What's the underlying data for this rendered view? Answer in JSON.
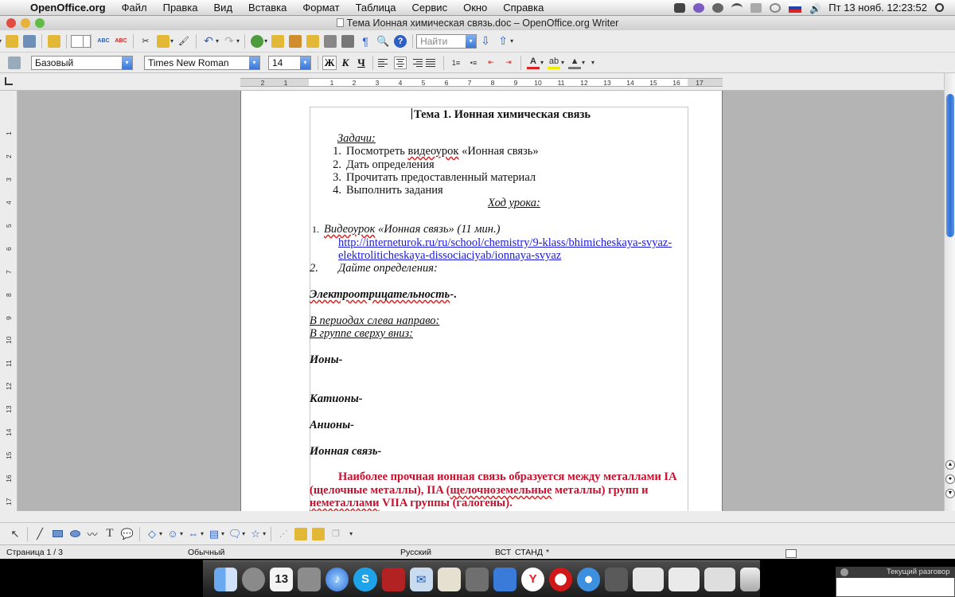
{
  "menubar": {
    "app_name": "OpenOffice.org",
    "items": [
      "Файл",
      "Правка",
      "Вид",
      "Вставка",
      "Формат",
      "Таблица",
      "Сервис",
      "Окно",
      "Справка"
    ],
    "clock": "Пт 13 нояб.  12:23:52"
  },
  "window": {
    "title": "Тема Ионная химическая связь.doc – OpenOffice.org Writer"
  },
  "toolbar": {
    "search_placeholder": "Найти"
  },
  "formatting": {
    "style": "Базовый",
    "font": "Times New Roman",
    "size": "14",
    "bold_label": "Ж",
    "italic_label": "К",
    "underline_label": "Ч"
  },
  "ruler": {
    "labels": [
      "2",
      "1",
      "",
      "1",
      "2",
      "3",
      "4",
      "5",
      "6",
      "7",
      "8",
      "9",
      "10",
      "11",
      "12",
      "13",
      "14",
      "15",
      "16",
      "17"
    ]
  },
  "vruler": {
    "labels": [
      "1",
      "2",
      "3",
      "4",
      "5",
      "6",
      "7",
      "8",
      "9",
      "10",
      "11",
      "12",
      "13",
      "14",
      "15",
      "16",
      "17"
    ]
  },
  "document": {
    "title": "Тема 1. Ионная химическая связь",
    "tasks_heading": "Задачи:",
    "tasks": [
      {
        "num": "1.",
        "text_pre": "Посмотреть ",
        "text_err": "видеоурок",
        "text_post": " «Ионная связь»"
      },
      {
        "num": "2.",
        "text": "Дать определения"
      },
      {
        "num": "3.",
        "text": "Прочитать предоставленный материал"
      },
      {
        "num": "4.",
        "text": "Выполнить задания"
      }
    ],
    "lesson_heading": "Ход урока:",
    "step1_num": "1.",
    "step1_err": "Видеоурок",
    "step1_text": " «Ионная связь» (11 мин.)",
    "link_line1": "http://interneturok.ru/ru/school/chemistry/9-klass/bhimicheskaya-svyaz-",
    "link_line2": "elektroliticheskaya-dissociaciyab/ionnaya-svyaz",
    "step2_num": "2.",
    "step2_text": "Дайте определения:",
    "electroneg": "Электроотрицательность",
    "electroneg_tail": "-.",
    "periods": "В периодах слева направо:",
    "groups": "В группе сверху вниз:",
    "ions": "Ионы-",
    "cations": "Катионы-",
    "anions": "Анионы-",
    "ionic_bond": "Ионная связь-",
    "red_p1": "Наиболее прочная ионная связь образуется между металлами IA",
    "red_p2a": "(щелочные металлы),  IIA (",
    "red_p2err": "щелочноземельные",
    "red_p2b": " металлы) групп и",
    "red_p3err": "неметаллами",
    "red_p3b": " VIIA группы (галогены)."
  },
  "statusbar": {
    "page": "Страница   1 / 3",
    "style": "Обычный",
    "language": "Русский",
    "insert": "ВСТ",
    "selection": "СТАНД",
    "modified": "*"
  },
  "callwindow": {
    "title": "Текущий разговор"
  }
}
